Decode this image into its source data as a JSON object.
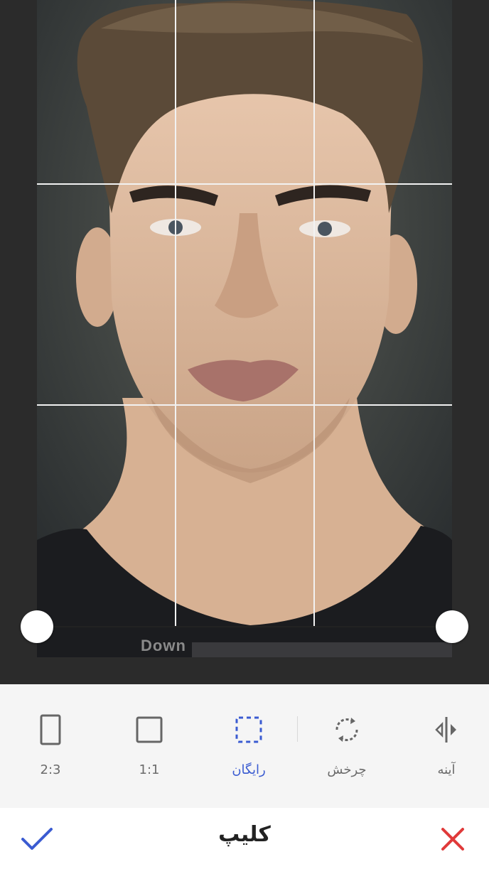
{
  "screen": {
    "title": "کلیپ"
  },
  "editor": {
    "watermark_text": "Down"
  },
  "tools": [
    {
      "id": "mirror",
      "label": "آینه",
      "icon": "mirror-icon",
      "active": false
    },
    {
      "id": "rotate",
      "label": "چرخش",
      "icon": "rotate-icon",
      "active": false
    },
    {
      "id": "free",
      "label": "رایگان",
      "icon": "free-crop-icon",
      "active": true
    },
    {
      "id": "square",
      "label": "1:1",
      "icon": "square-ratio-icon",
      "active": false
    },
    {
      "id": "portrait",
      "label": "2:3",
      "icon": "portrait-ratio-icon",
      "active": false
    }
  ],
  "colors": {
    "accent": "#3a5bd1",
    "cancel": "#e03a3a",
    "confirm": "#3a5bd1"
  }
}
